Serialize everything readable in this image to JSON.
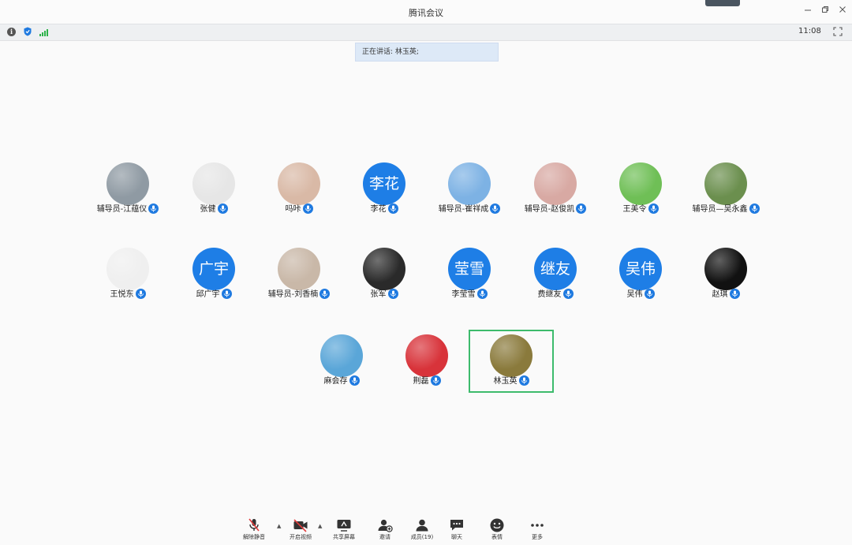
{
  "window": {
    "title": "腾讯会议",
    "time": "11:08"
  },
  "speaking": {
    "text": "正在讲话: 林玉英;"
  },
  "participants": [
    {
      "name": "辅导员-江蕴仪",
      "avatar": "photo-lake",
      "color": "#8f9aa3"
    },
    {
      "name": "张健",
      "avatar": "photo-sketch",
      "color": "#e6e6e6"
    },
    {
      "name": "吗咔",
      "avatar": "photo-child",
      "color": "#d9b9a6"
    },
    {
      "name": "李花",
      "avatar_text": "李花",
      "color": "#1e7ee6"
    },
    {
      "name": "辅导员-崔祥成",
      "avatar": "photo-sky",
      "color": "#7db2e4"
    },
    {
      "name": "辅导员-赵俊凯",
      "avatar": "photo-pink",
      "color": "#d8a9a3"
    },
    {
      "name": "王美令",
      "avatar": "photo-sprout",
      "color": "#6fbf56"
    },
    {
      "name": "辅导员—吴永鑫",
      "avatar": "photo-man",
      "color": "#6b8f4e"
    },
    {
      "name": "王悦东",
      "avatar": "photo-drawing",
      "color": "#efefef"
    },
    {
      "name": "邱广宇",
      "avatar_text": "广宇",
      "color": "#1e7ee6"
    },
    {
      "name": "辅导员-刘香楠",
      "avatar": "photo-rabbit",
      "color": "#c9b8a8"
    },
    {
      "name": "张军",
      "avatar": "photo-sphere",
      "color": "#2a2a2a"
    },
    {
      "name": "李莹雪",
      "avatar_text": "莹雪",
      "color": "#1e7ee6"
    },
    {
      "name": "费继友",
      "avatar_text": "继友",
      "color": "#1e7ee6"
    },
    {
      "name": "吴伟",
      "avatar_text": "吴伟",
      "color": "#1e7ee6"
    },
    {
      "name": "赵琪",
      "avatar": "photo-bear",
      "color": "#111111"
    },
    {
      "name": "麻会存",
      "avatar": "photo-island",
      "color": "#5aa6d8"
    },
    {
      "name": "荆磊",
      "avatar": "photo-couple",
      "color": "#d8333a"
    },
    {
      "name": "林玉英",
      "avatar": "photo-ducks",
      "color": "#8a7a3c",
      "active": true
    }
  ],
  "toolbar": [
    {
      "label": "解除静音",
      "icon": "mic-muted-icon"
    },
    {
      "label": "开启视频",
      "icon": "video-off-icon"
    },
    {
      "label": "共享屏幕",
      "icon": "share-screen-icon"
    },
    {
      "label": "邀请",
      "icon": "invite-icon"
    },
    {
      "label": "成员(19)",
      "icon": "members-icon"
    },
    {
      "label": "聊天",
      "icon": "chat-icon"
    },
    {
      "label": "表情",
      "icon": "emoji-icon"
    },
    {
      "label": "更多",
      "icon": "more-icon"
    }
  ],
  "colors": {
    "accent": "#1e7ee6",
    "active_border": "#3dbb6c",
    "signal": "#2db24a"
  }
}
